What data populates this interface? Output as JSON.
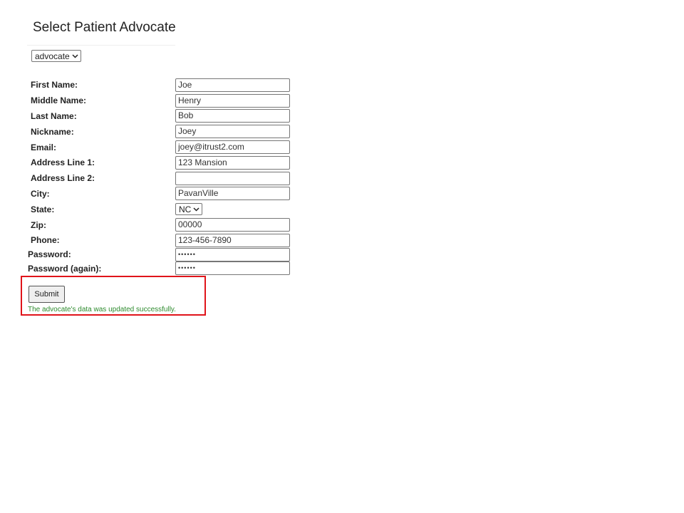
{
  "page": {
    "title": "Select Patient Advocate"
  },
  "advocate_select": {
    "selected": "advocate"
  },
  "form": {
    "first_name": {
      "label": "First Name:",
      "value": "Joe"
    },
    "middle_name": {
      "label": "Middle Name:",
      "value": "Henry"
    },
    "last_name": {
      "label": "Last Name:",
      "value": "Bob"
    },
    "nickname": {
      "label": "Nickname:",
      "value": "Joey"
    },
    "email": {
      "label": "Email:",
      "value": "joey@itrust2.com"
    },
    "address1": {
      "label": "Address Line 1:",
      "value": "123 Mansion"
    },
    "address2": {
      "label": "Address Line 2:",
      "value": ""
    },
    "city": {
      "label": "City:",
      "value": "PavanVille"
    },
    "state": {
      "label": "State:",
      "value": "NC"
    },
    "zip": {
      "label": "Zip:",
      "value": "00000"
    },
    "phone": {
      "label": "Phone:",
      "value": "123-456-7890"
    },
    "password": {
      "label": "Password:",
      "value": "••••••"
    },
    "password_again": {
      "label": "Password (again):",
      "value": "••••••"
    }
  },
  "actions": {
    "submit_label": "Submit",
    "success_message": "The advocate's data was updated successfully."
  },
  "colors": {
    "success_text": "#2e8b2e",
    "highlight_border": "#e0141a"
  },
  "icons": {
    "dropdown": "chevron-down-icon"
  }
}
